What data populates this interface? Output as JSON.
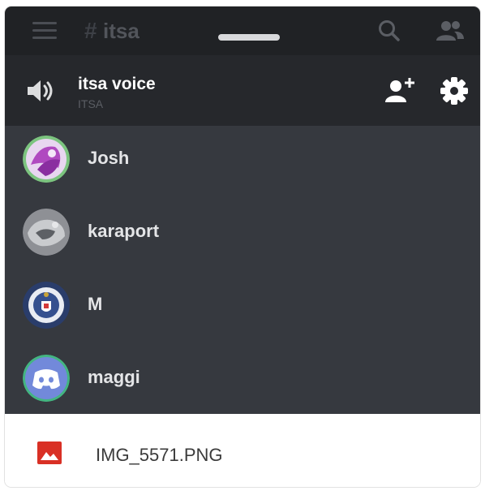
{
  "topbar": {
    "menu_icon": "hamburger-icon",
    "hash": "#",
    "channel_name": "itsa",
    "search_icon": "search-icon",
    "members_icon": "people-icon"
  },
  "voice_channel": {
    "title": "itsa voice",
    "server": "ITSA",
    "speaker_icon": "speaker-icon",
    "invite_icon": "add-user-icon",
    "settings_icon": "gear-icon"
  },
  "members": [
    {
      "name": "Josh"
    },
    {
      "name": "karaport"
    },
    {
      "name": "M"
    },
    {
      "name": "maggi"
    }
  ],
  "download": {
    "file_name": "IMG_5571.PNG",
    "file_icon": "image-file-icon"
  },
  "colors": {
    "topbar_bg": "#202225",
    "header_bg": "#26282c",
    "list_bg": "#36393f",
    "discord_blurple": "#7289da",
    "file_icon_red": "#d93025"
  }
}
